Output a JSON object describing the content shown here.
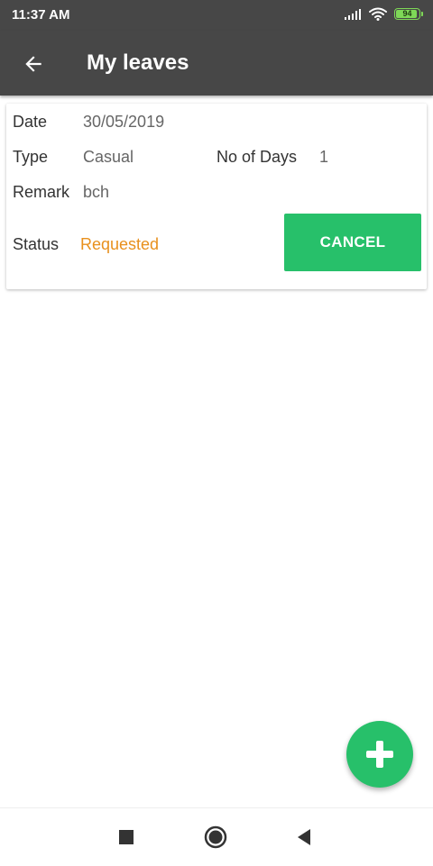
{
  "status_bar": {
    "time": "11:37 AM",
    "battery_level": "94",
    "icons": [
      "signal-icon",
      "wifi-icon",
      "battery-icon"
    ]
  },
  "app_bar": {
    "title": "My leaves",
    "back_icon": "back-arrow-icon"
  },
  "leave_card": {
    "date_label": "Date",
    "date_value": "30/05/2019",
    "type_label": "Type",
    "type_value": "Casual",
    "days_label": "No of Days",
    "days_value": "1",
    "remark_label": "Remark",
    "remark_value": "bch",
    "status_label": "Status",
    "status_value": "Requested",
    "cancel_label": "CANCEL"
  },
  "fab": {
    "icon": "plus-icon"
  },
  "nav_bar": {
    "icons": [
      "recents-square-icon",
      "home-circle-icon",
      "back-triangle-icon"
    ]
  },
  "colors": {
    "app_bar": "#474747",
    "accent_green": "#27c06a",
    "status_orange": "#e8901d",
    "battery_green": "#7ed957"
  }
}
